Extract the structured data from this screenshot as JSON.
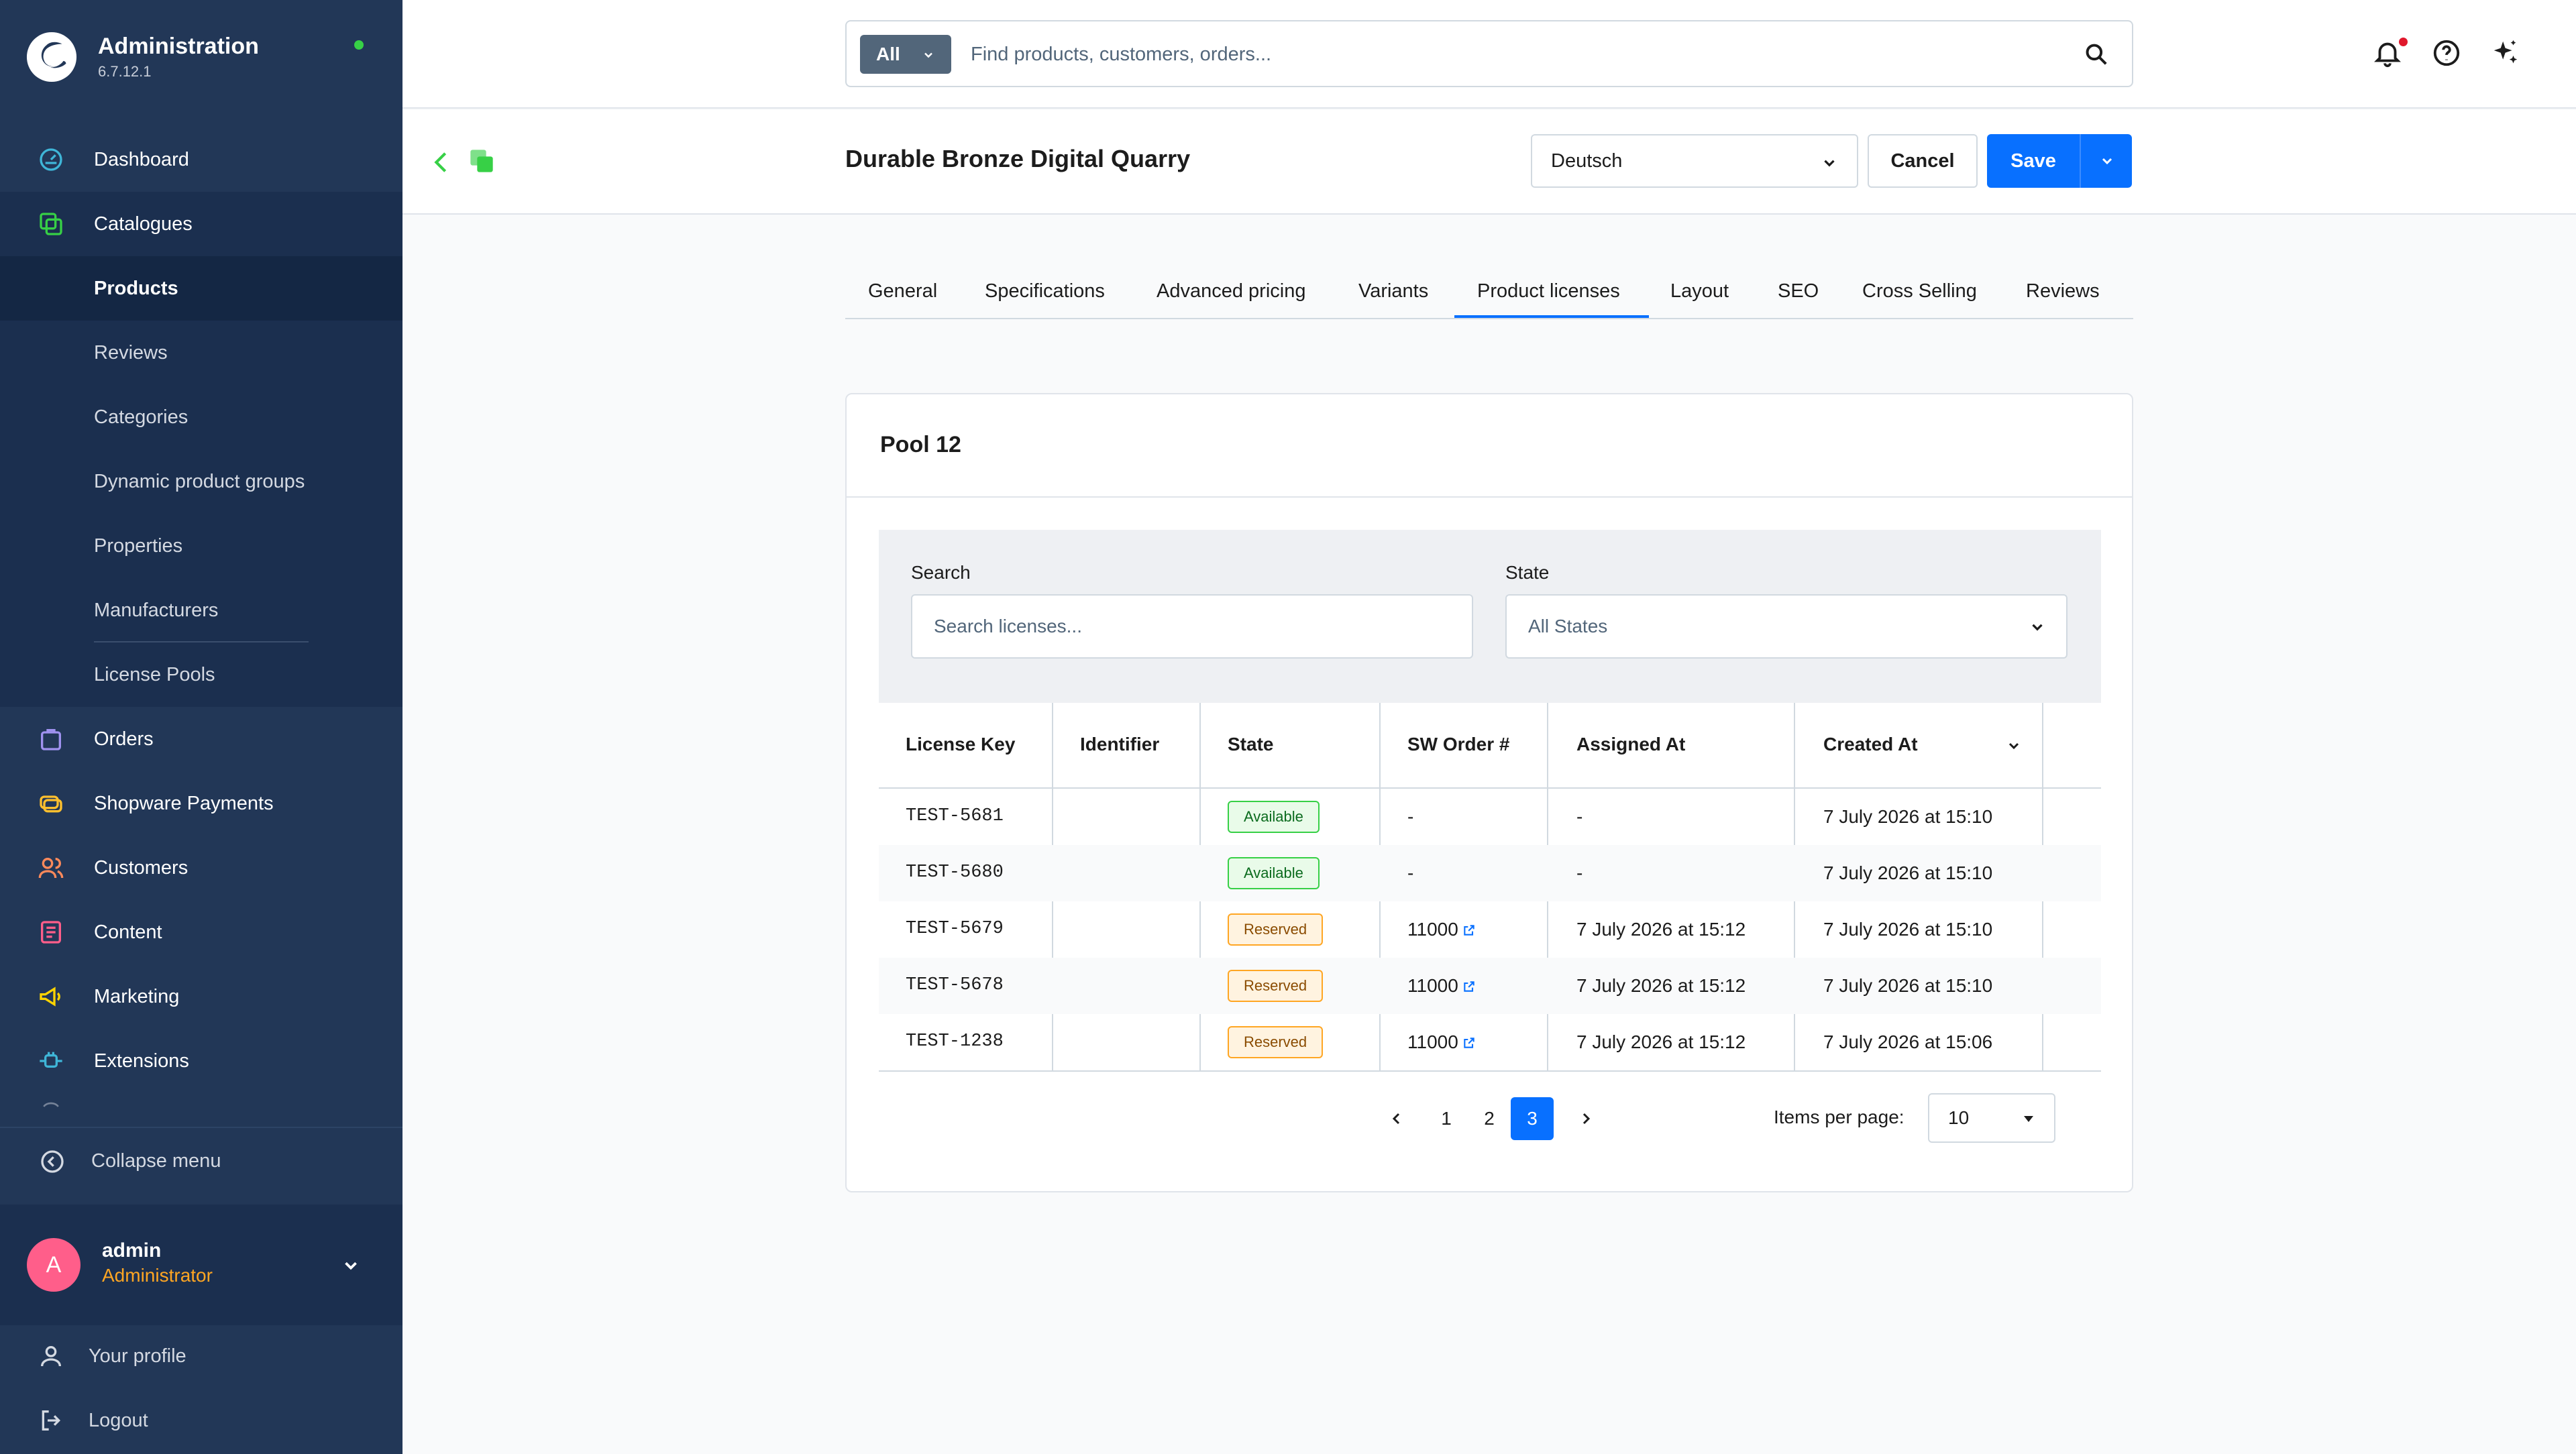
{
  "app": {
    "title": "Administration",
    "version": "6.7.12.1"
  },
  "nav": {
    "dashboard": "Dashboard",
    "catalogues": "Catalogues",
    "catalogue_items": [
      "Products",
      "Reviews",
      "Categories",
      "Dynamic product groups",
      "Properties",
      "Manufacturers",
      "License Pools"
    ],
    "orders": "Orders",
    "payments": "Shopware Payments",
    "customers": "Customers",
    "content": "Content",
    "marketing": "Marketing",
    "extensions": "Extensions",
    "collapse": "Collapse menu"
  },
  "user": {
    "initial": "A",
    "name": "admin",
    "role": "Administrator"
  },
  "footer": {
    "profile": "Your profile",
    "logout": "Logout"
  },
  "search": {
    "scope": "All",
    "placeholder": "Find products, customers, orders..."
  },
  "smartbar": {
    "title": "Durable Bronze Digital Quarry",
    "language": "Deutsch",
    "cancel": "Cancel",
    "save": "Save"
  },
  "tabs": [
    "General",
    "Specifications",
    "Advanced pricing",
    "Variants",
    "Product licenses",
    "Layout",
    "SEO",
    "Cross Selling",
    "Reviews"
  ],
  "active_tab": "Product licenses",
  "pool": {
    "title": "Pool 12",
    "search_label": "Search",
    "search_placeholder": "Search licenses...",
    "state_label": "State",
    "state_value": "All States"
  },
  "table": {
    "headers": [
      "License Key",
      "Identifier",
      "State",
      "SW Order #",
      "Assigned At",
      "Created At"
    ],
    "rows": [
      {
        "key": "TEST-5681",
        "identifier": "",
        "state": "Available",
        "order": "-",
        "assigned": "-",
        "created": "7 July 2026 at 15:10"
      },
      {
        "key": "TEST-5680",
        "identifier": "",
        "state": "Available",
        "order": "-",
        "assigned": "-",
        "created": "7 July 2026 at 15:10"
      },
      {
        "key": "TEST-5679",
        "identifier": "",
        "state": "Reserved",
        "order": "11000",
        "assigned": "7 July 2026 at 15:12",
        "created": "7 July 2026 at 15:10"
      },
      {
        "key": "TEST-5678",
        "identifier": "",
        "state": "Reserved",
        "order": "11000",
        "assigned": "7 July 2026 at 15:12",
        "created": "7 July 2026 at 15:10"
      },
      {
        "key": "TEST-1238",
        "identifier": "",
        "state": "Reserved",
        "order": "11000",
        "assigned": "7 July 2026 at 15:12",
        "created": "7 July 2026 at 15:06"
      }
    ]
  },
  "pagination": {
    "pages": [
      "1",
      "2",
      "3"
    ],
    "current": "3",
    "items_label": "Items per page:",
    "items_value": "10"
  },
  "colors": {
    "sidebar": "#223757",
    "accent": "#0870ff",
    "available": "#37d046",
    "reserved": "#ffa623",
    "avatar": "#ff5e8a"
  }
}
